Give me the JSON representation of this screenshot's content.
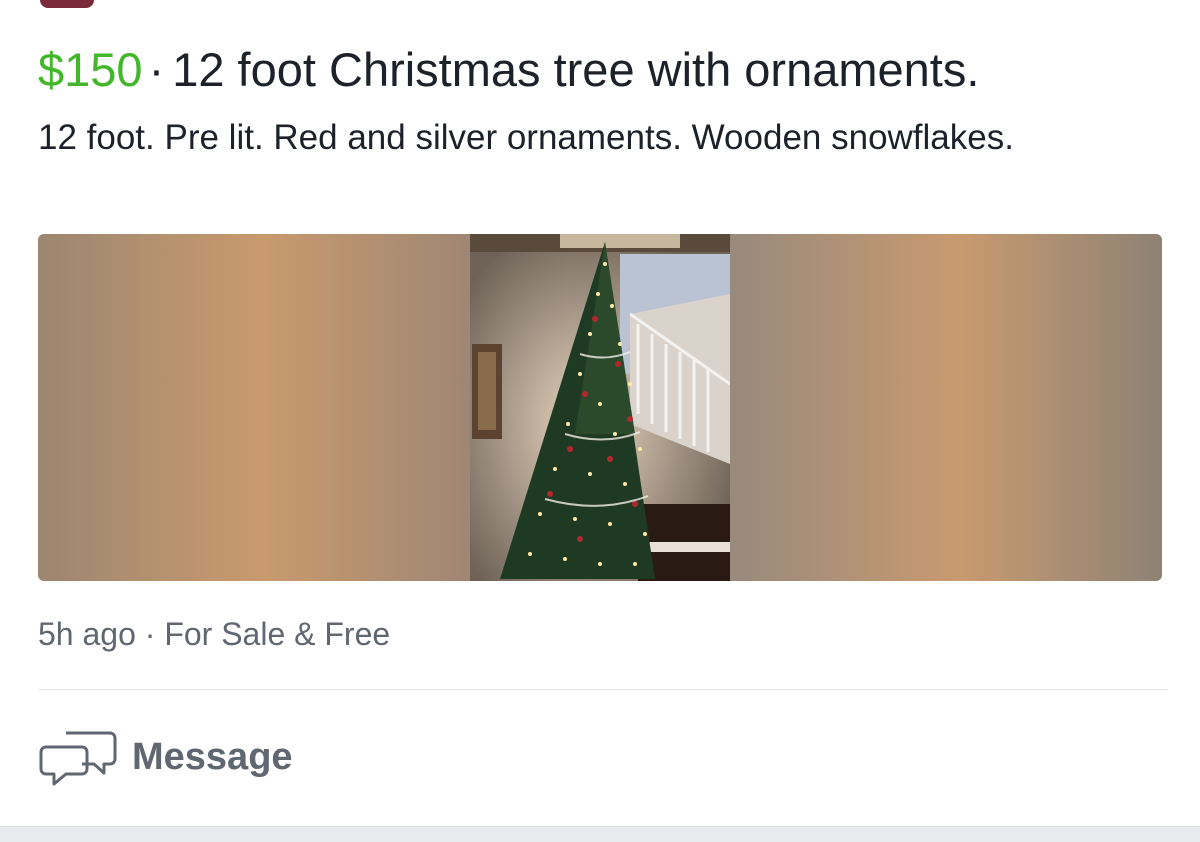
{
  "post": {
    "price": "$150",
    "separator": "·",
    "title": "12 foot Christmas tree with ornaments.",
    "description": "12 foot. Pre lit. Red and silver ornaments. Wooden snowflakes.",
    "meta": "5h ago · For Sale & Free",
    "photo_icon": "christmas-tree-photo"
  },
  "actions": {
    "message_label": "Message",
    "message_icon": "chat-bubbles-icon"
  },
  "colors": {
    "price": "#42b72a",
    "text": "#1d2129",
    "secondary_text": "#606770"
  }
}
